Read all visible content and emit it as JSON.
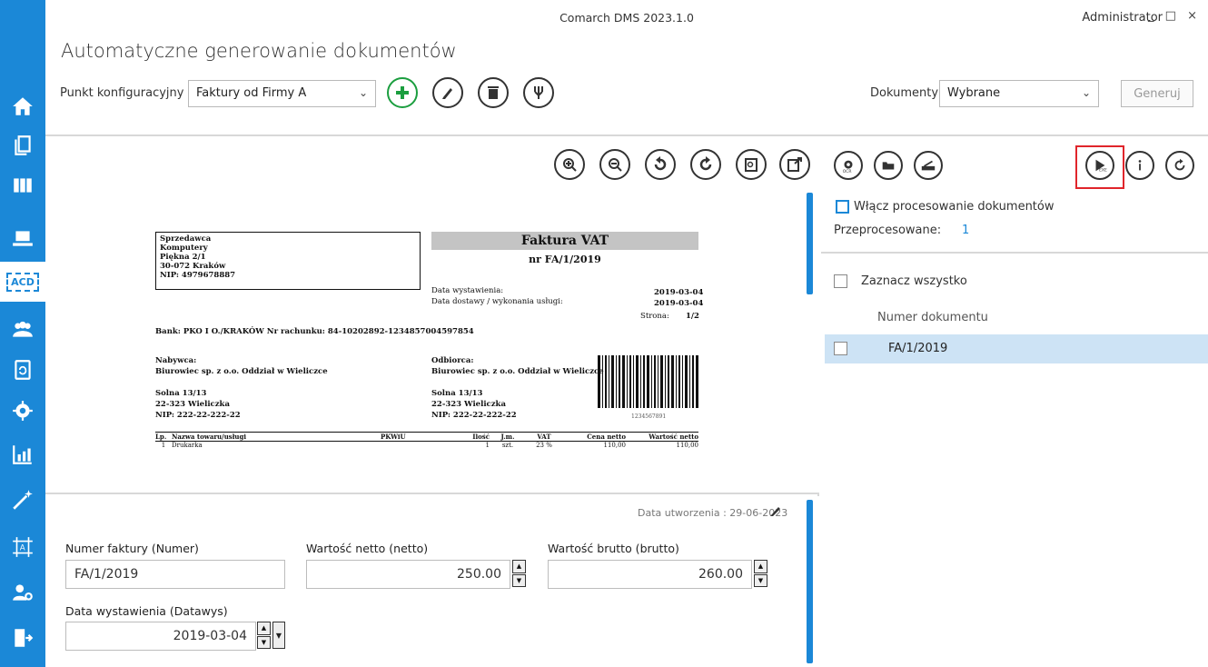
{
  "window": {
    "title": "Comarch DMS 2023.1.0",
    "user": "Administrator",
    "controls": "_ □ ×"
  },
  "page": {
    "title": "Automatyczne generowanie dokumentów"
  },
  "config": {
    "label": "Punkt konfiguracyjny",
    "selected": "Faktury od Firmy A"
  },
  "documents": {
    "label": "Dokumenty",
    "selected": "Wybrane",
    "generate_label": "Generuj"
  },
  "sidebar": {
    "items": [
      "home-icon",
      "documents-icon",
      "columns-icon",
      "laptop-icon",
      "acd-icon",
      "users-icon",
      "document-cycle-icon",
      "settings-icon",
      "chart-icon",
      "wand-icon",
      "template-icon",
      "user-settings-icon",
      "logout-icon"
    ],
    "acd_label": "ACD"
  },
  "invoice": {
    "seller_label": "Sprzedawca",
    "seller_name": "Komputery",
    "seller_street": "Piękna 2/1",
    "seller_city": "30-072 Kraków",
    "seller_nip": "NIP: 4979678887",
    "title": "Faktura VAT",
    "number": "nr FA/1/2019",
    "issue_label": "Data wystawienia:",
    "issue_date": "2019-03-04",
    "delivery_label": "Data dostawy / wykonania usługi:",
    "delivery_date": "2019-03-04",
    "page_label": "Strona:",
    "page_value": "1/2",
    "bank": "Bank: PKO I O./KRAKÓW  Nr rachunku: 84-10202892-1234857004597854",
    "buyer_label": "Nabywca:",
    "buyer_name": "Biurowiec sp. z o.o. Oddział w Wieliczce",
    "buyer_street": "Solna 13/13",
    "buyer_city": "22-323 Wieliczka",
    "buyer_nip": "NIP: 222-22-222-22",
    "recipient_label": "Odbiorca:",
    "recipient_name": "Biurowiec sp. z o.o. Oddział w Wieliczce",
    "recipient_street": "Solna 13/13",
    "recipient_city": "22-323 Wieliczka",
    "recipient_nip": "NIP: 222-22-222-22",
    "barcode_number": "1234567891",
    "table_headers": [
      "Lp.",
      "Nazwa towaru/usługi",
      "PKWiU",
      "Ilość",
      "J.m.",
      "VAT",
      "Cena netto",
      "Wartość netto"
    ],
    "row": [
      "1",
      "Drukarka",
      "",
      "1",
      "szt.",
      "23 %",
      "110,00",
      "110,00"
    ]
  },
  "form": {
    "created_label": "Data utworzenia : 29-06-2023",
    "invoice_number_label": "Numer faktury (Numer)",
    "invoice_number_value": "FA/1/2019",
    "net_label": "Wartość netto (netto)",
    "net_value": "250.00",
    "gross_label": "Wartość brutto (brutto)",
    "gross_value": "260.00",
    "issue_date_label": "Data wystawienia (Datawys)",
    "issue_date_value": "2019-03-04"
  },
  "right": {
    "processing_label": "Włącz procesowanie dokumentów",
    "processed_label": "Przeprocesowane:",
    "processed_value": "1",
    "select_all_label": "Zaznacz wszystko",
    "column_header": "Numer dokumentu",
    "rows": [
      "FA/1/2019"
    ]
  },
  "colors": {
    "accent": "#1b88d7",
    "highlight": "#e0252b",
    "green": "#1b9e3f",
    "selected_row": "#cde3f5"
  }
}
